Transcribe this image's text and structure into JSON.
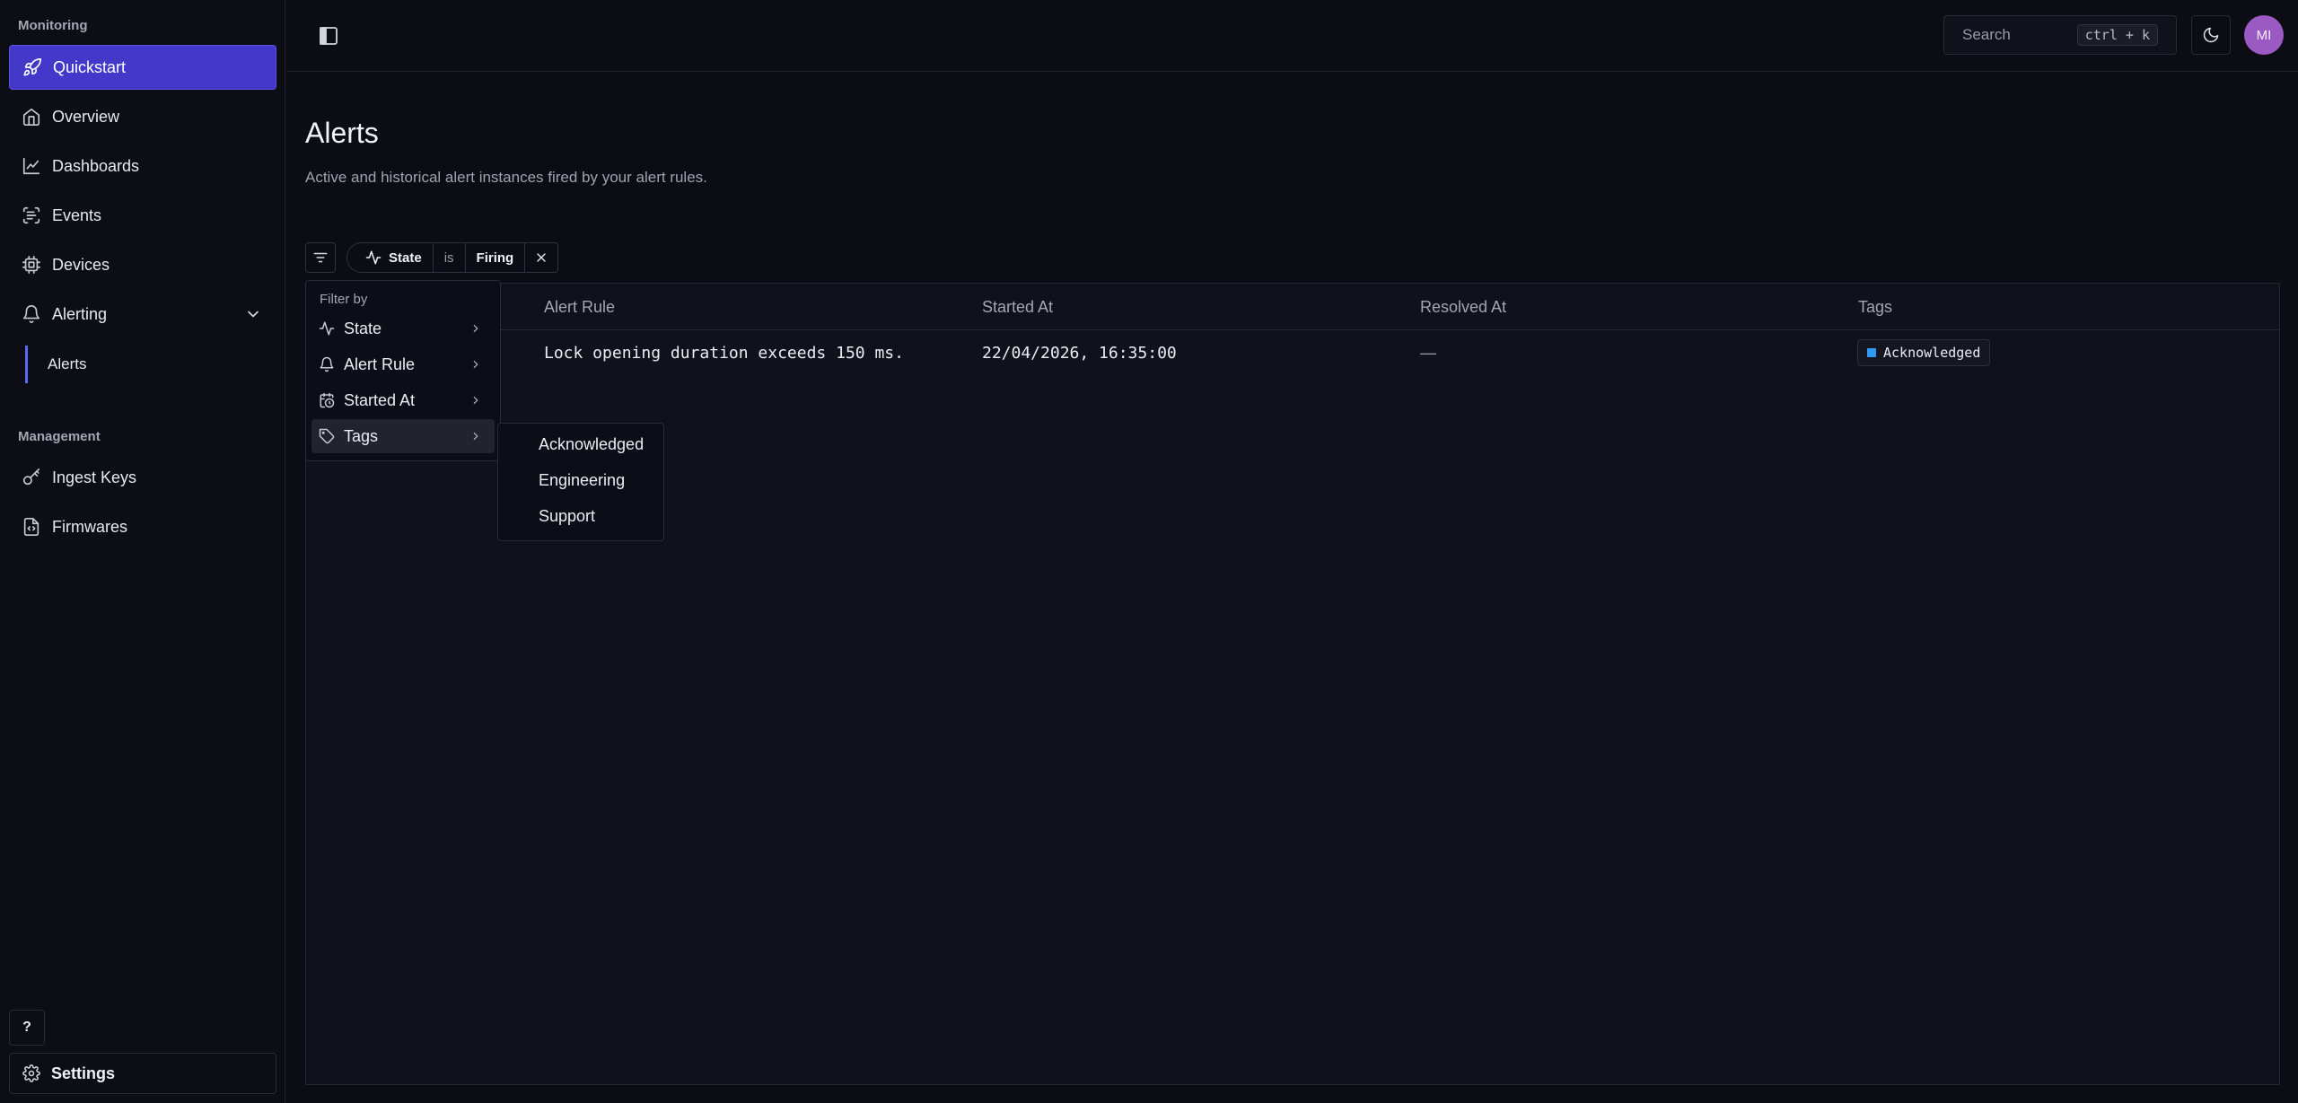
{
  "sidebar": {
    "monitoring_label": "Monitoring",
    "management_label": "Management",
    "items": [
      {
        "label": "Quickstart"
      },
      {
        "label": "Overview"
      },
      {
        "label": "Dashboards"
      },
      {
        "label": "Events"
      },
      {
        "label": "Devices"
      },
      {
        "label": "Alerting"
      },
      {
        "label": "Ingest Keys"
      },
      {
        "label": "Firmwares"
      }
    ],
    "alerting_sub": {
      "label": "Alerts"
    },
    "help_label": "?",
    "settings_label": "Settings"
  },
  "topbar": {
    "search_placeholder": "Search",
    "search_shortcut": "ctrl + k",
    "avatar_initials": "MI"
  },
  "page": {
    "title": "Alerts",
    "subtitle": "Active and historical alert instances fired by your alert rules."
  },
  "filter_chip": {
    "field": "State",
    "operator": "is",
    "value": "Firing"
  },
  "table": {
    "columns": [
      "Alert Rule",
      "Started At",
      "Resolved At",
      "Tags"
    ],
    "rows": [
      {
        "alert_rule": "Lock opening duration exceeds 150 ms.",
        "started_at": "22/04/2026, 16:35:00",
        "resolved_at": "—",
        "tag": "Acknowledged"
      }
    ]
  },
  "filter_menu": {
    "header": "Filter by",
    "items": [
      {
        "label": "State",
        "icon": "activity-icon"
      },
      {
        "label": "Alert Rule",
        "icon": "bell-icon"
      },
      {
        "label": "Started At",
        "icon": "calendar-clock-icon"
      },
      {
        "label": "Tags",
        "icon": "tag-icon"
      }
    ],
    "submenu": [
      "Acknowledged",
      "Engineering",
      "Support"
    ]
  },
  "colors": {
    "accent": "#4338ca",
    "tag_color": "#2e9bf0",
    "avatar": "#9b59c4"
  }
}
